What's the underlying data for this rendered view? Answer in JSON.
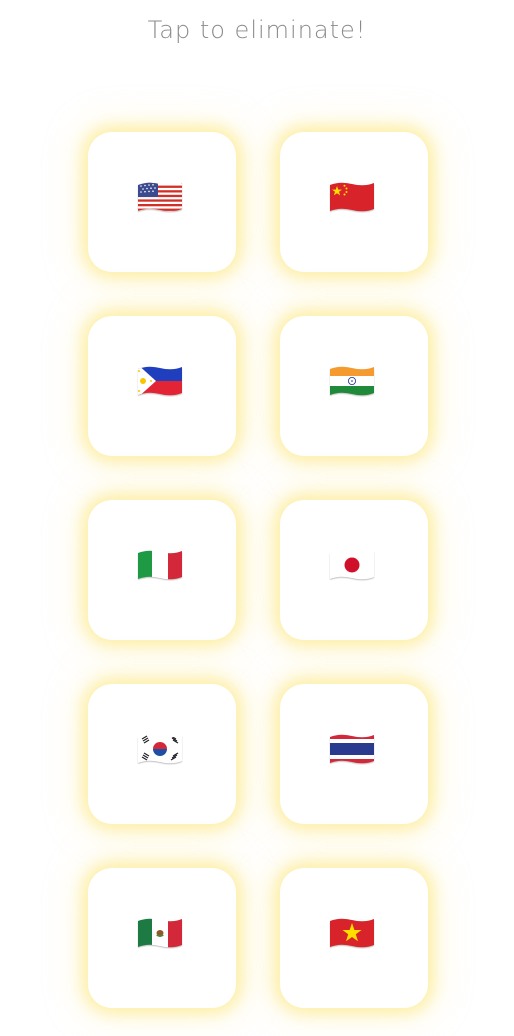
{
  "header": {
    "title": "Tap to eliminate!"
  },
  "cards": [
    {
      "flag": "us-flag-icon",
      "country": "United States"
    },
    {
      "flag": "cn-flag-icon",
      "country": "China"
    },
    {
      "flag": "ph-flag-icon",
      "country": "Philippines"
    },
    {
      "flag": "in-flag-icon",
      "country": "India"
    },
    {
      "flag": "it-flag-icon",
      "country": "Italy"
    },
    {
      "flag": "jp-flag-icon",
      "country": "Japan"
    },
    {
      "flag": "kr-flag-icon",
      "country": "South Korea"
    },
    {
      "flag": "th-flag-icon",
      "country": "Thailand"
    },
    {
      "flag": "mx-flag-icon",
      "country": "Mexico"
    },
    {
      "flag": "vn-flag-icon",
      "country": "Vietnam"
    }
  ],
  "colors": {
    "title": "#8a8a8a",
    "card_background": "#ffffff",
    "card_glow": "#fce678"
  }
}
